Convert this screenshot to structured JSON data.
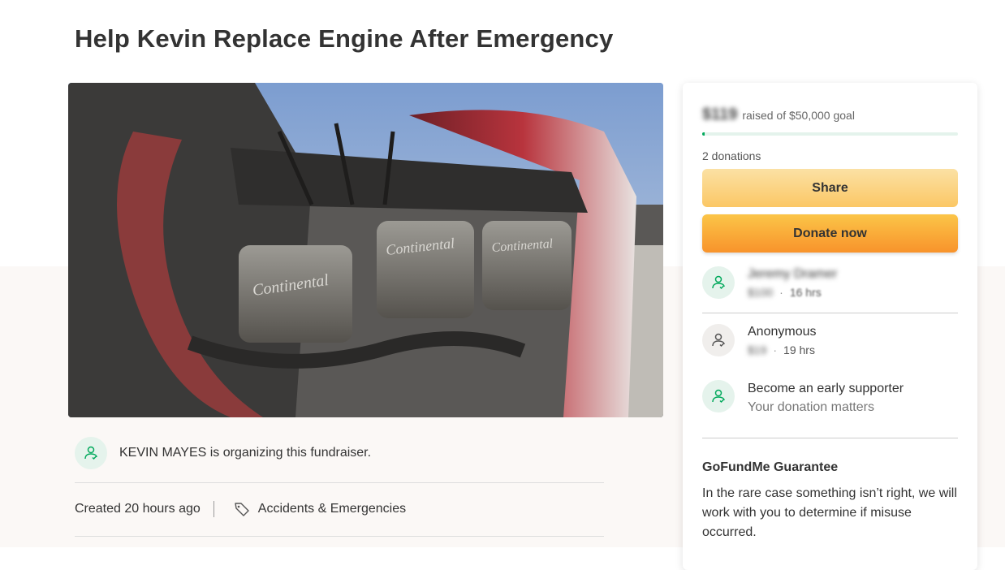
{
  "campaign": {
    "title": "Help Kevin Replace Engine After Emergency",
    "organizer_text": "KEVIN MAYES is organizing this fundraiser.",
    "created": "Created 20 hours ago",
    "category": "Accidents & Emergencies",
    "hero_image_text": [
      "Continental",
      "Continental",
      "Continental"
    ]
  },
  "card": {
    "raised_amount": "$119",
    "raised_label": "raised of $50,000 goal",
    "progress_fraction": 0.0024,
    "donations_count": "2 donations",
    "share_label": "Share",
    "donate_label": "Donate now",
    "donors": [
      {
        "name": "Jeremy Dramer",
        "amount": "$100",
        "time": "16 hrs",
        "name_blurred": true
      },
      {
        "name": "Anonymous",
        "amount": "$19",
        "time": "19 hrs",
        "name_blurred": false
      }
    ],
    "early_supporter": {
      "title": "Become an early supporter",
      "subtitle": "Your donation matters"
    },
    "guarantee": {
      "title": "GoFundMe Guarantee",
      "text": "In the rare case something isn’t right, we will work with you to determine if misuse occurred."
    }
  },
  "colors": {
    "accent_green": "#02a95c",
    "share_button": "#fbd27f",
    "donate_button": "#f8a53a"
  },
  "icons": [
    "heart-hand-icon",
    "tag-icon"
  ]
}
